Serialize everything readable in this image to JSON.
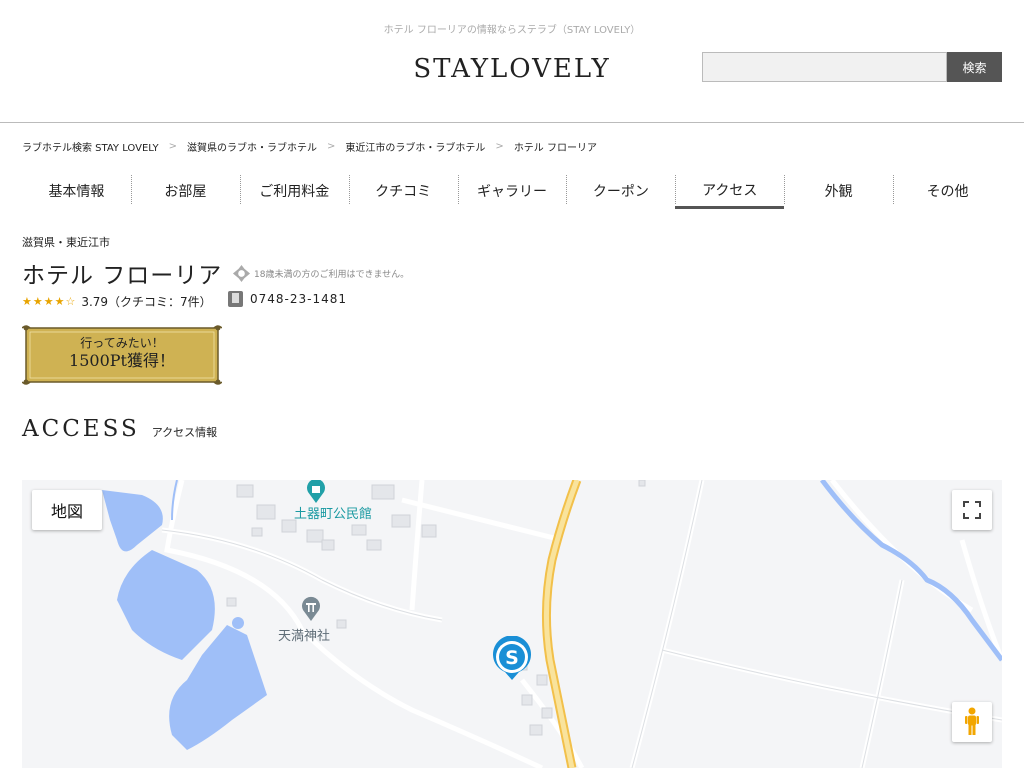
{
  "header": {
    "tagline": "ホテル フローリアの情報ならステラブ（STAY LOVELY）",
    "logo": "STAYLOVELY",
    "search_placeholder": "",
    "search_button": "検索"
  },
  "breadcrumb": [
    "ラブホテル検索 STAY LOVELY",
    "滋賀県のラブホ・ラブホテル",
    "東近江市のラブホ・ラブホテル",
    "ホテル フローリア"
  ],
  "breadcrumb_sep": ">",
  "tabs": [
    {
      "label": "基本情報",
      "active": false
    },
    {
      "label": "お部屋",
      "active": false
    },
    {
      "label": "ご利用料金",
      "active": false
    },
    {
      "label": "クチコミ",
      "active": false
    },
    {
      "label": "ギャラリー",
      "active": false
    },
    {
      "label": "クーポン",
      "active": false
    },
    {
      "label": "アクセス",
      "active": true
    },
    {
      "label": "外観",
      "active": false
    },
    {
      "label": "その他",
      "active": false
    }
  ],
  "hotel": {
    "location": "滋賀県・東近江市",
    "name": "ホテル フローリア",
    "age_notice": "18歳未満の方のご利用はできません。",
    "stars": "★★★★☆",
    "rating_text": "3.79（クチコミ：7件）",
    "phone": "0748-23-1481"
  },
  "point_button": {
    "line1": "行ってみたい！",
    "line2": "1500Pt獲得！"
  },
  "section": {
    "title_en": "ACCESS",
    "title_jp": "アクセス情報"
  },
  "map": {
    "type_button": "地図",
    "poi_community_hall": "土器町公民館",
    "poi_shrine": "天満神社",
    "colors": {
      "water": "#9fbff8",
      "road_major": "#f7d778",
      "poi_teal": "#21a0a8",
      "poi_gray": "#7a8a94",
      "marker": "#1a8fd6"
    }
  }
}
